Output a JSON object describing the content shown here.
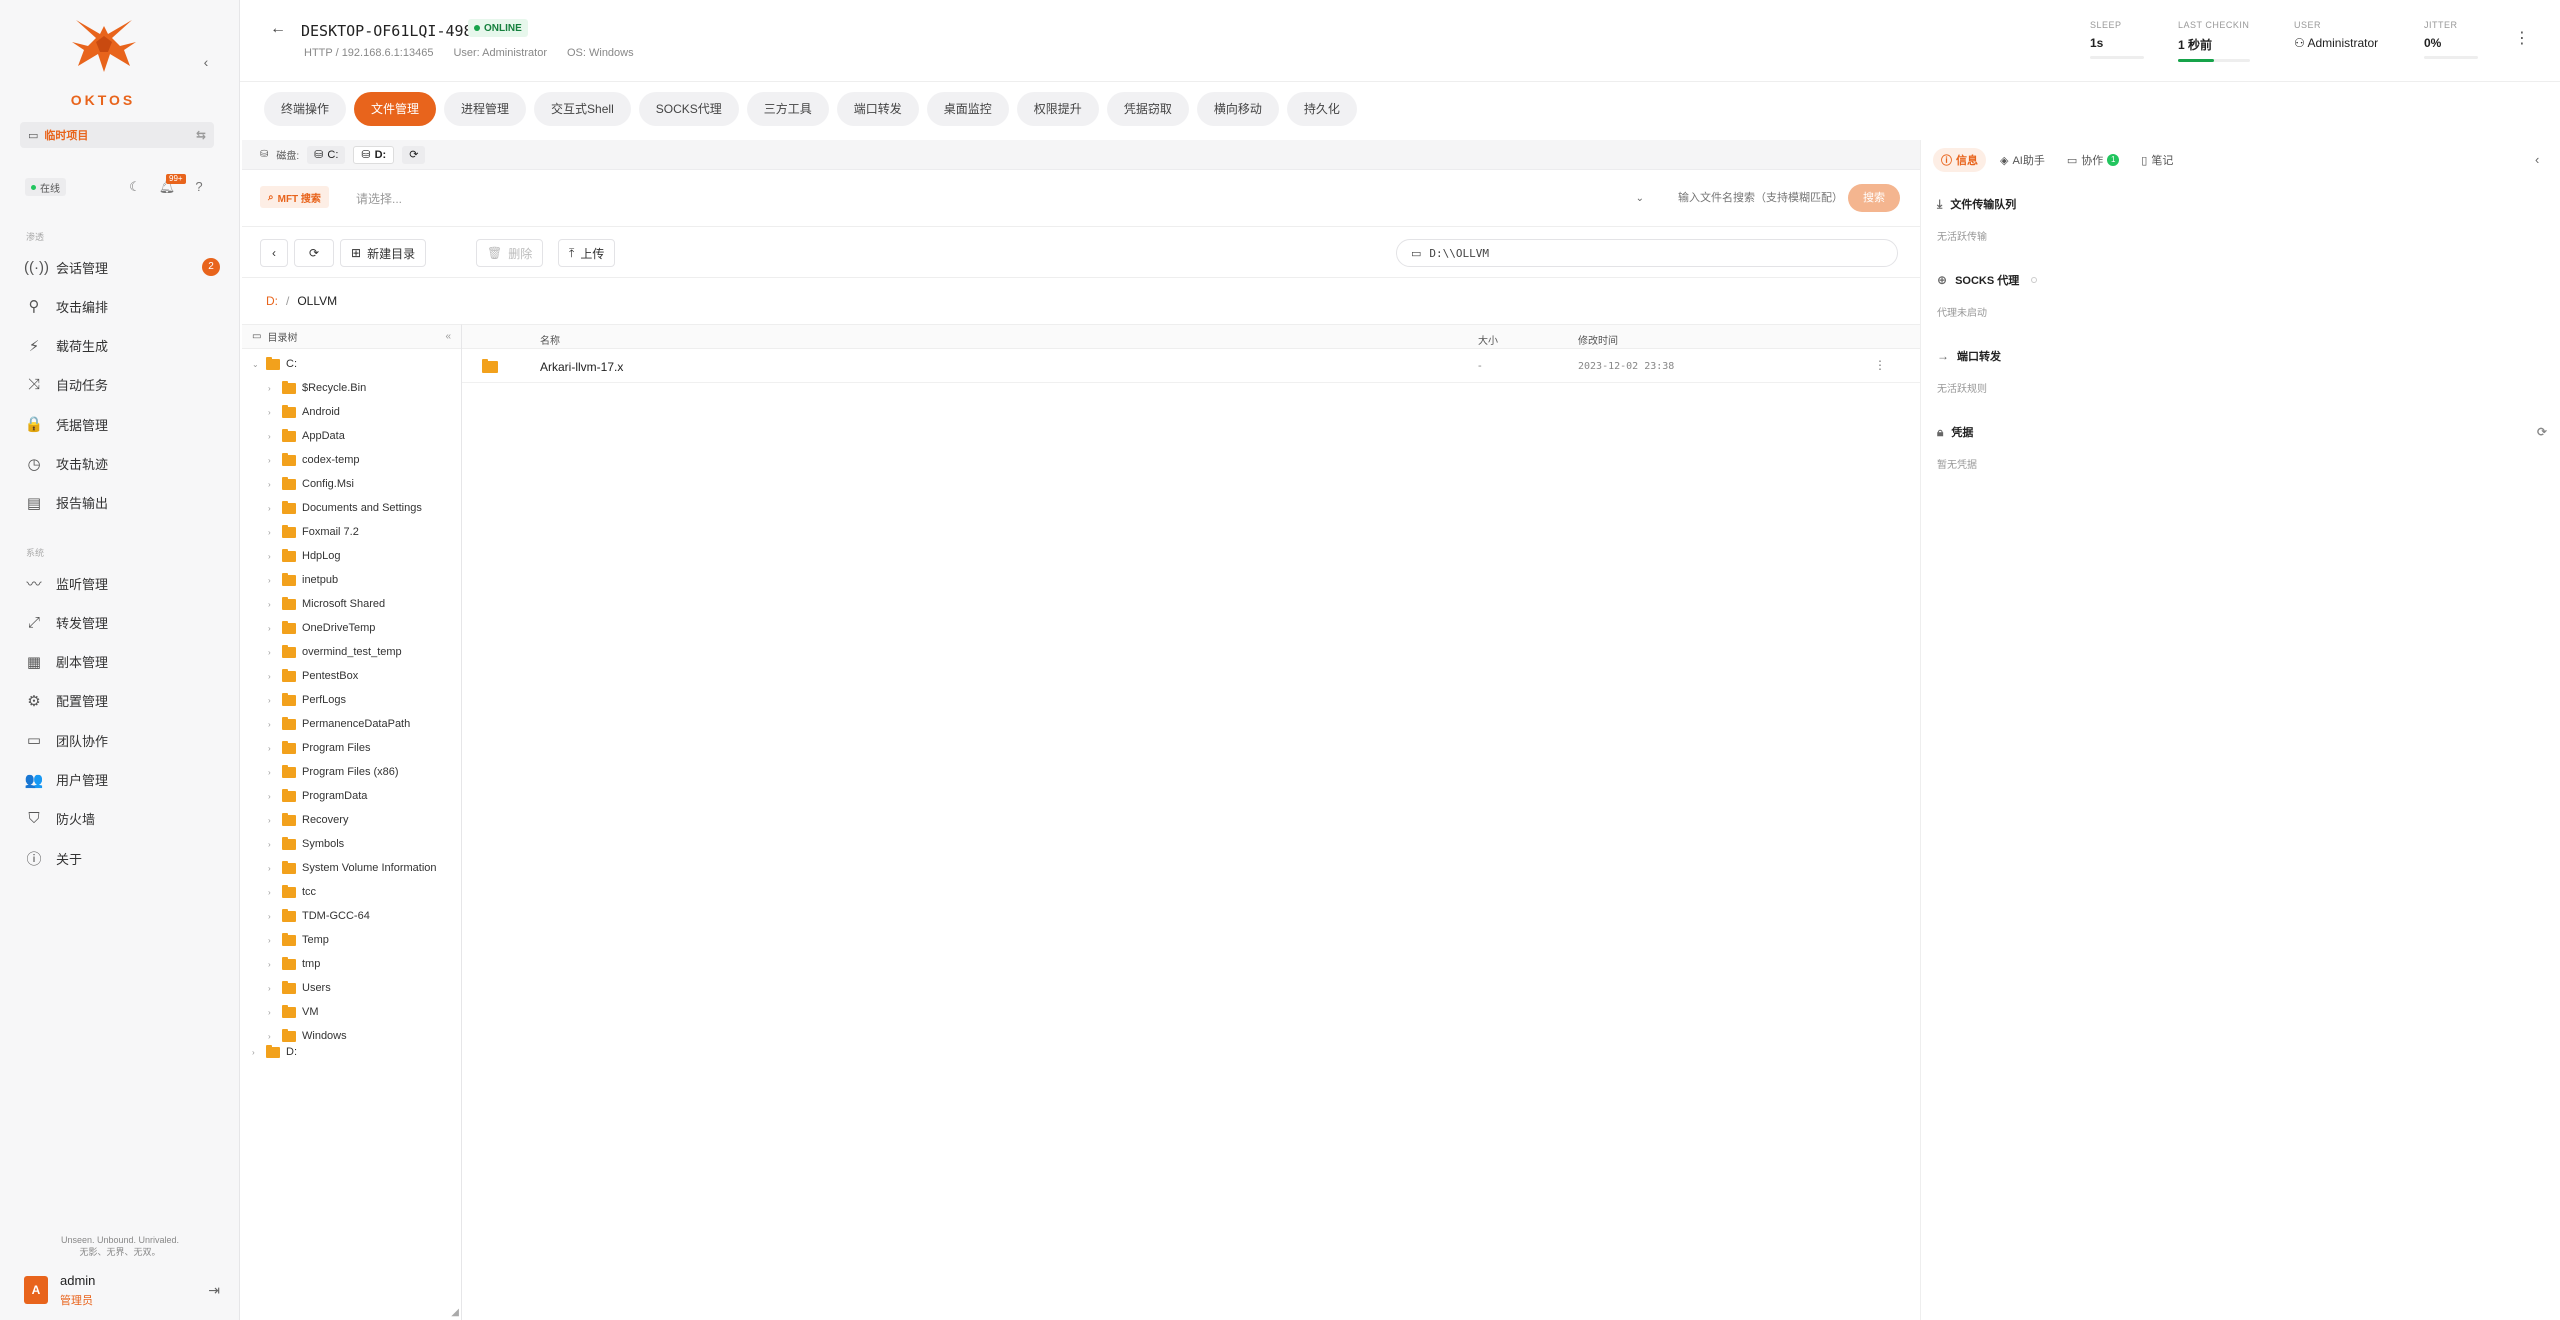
{
  "brand": {
    "name": "OKTOS"
  },
  "sidebar": {
    "project_label": "临时项目",
    "status": "在线",
    "notif_badge": "99+",
    "group_main": "渗透",
    "nav_main": [
      {
        "label": "会话管理",
        "icon": "sessions-icon",
        "glyph": "((·))",
        "badge": "2"
      },
      {
        "label": "攻击编排",
        "icon": "attack-orchestration-icon",
        "glyph": "⚲"
      },
      {
        "label": "载荷生成",
        "icon": "payload-icon",
        "glyph": "⚡"
      },
      {
        "label": "自动任务",
        "icon": "auto-task-icon",
        "glyph": "⤨"
      },
      {
        "label": "凭据管理",
        "icon": "credential-lock-icon",
        "glyph": "🔒"
      },
      {
        "label": "攻击轨迹",
        "icon": "timeline-clock-icon",
        "glyph": "◷"
      },
      {
        "label": "报告输出",
        "icon": "report-icon",
        "glyph": "▤"
      }
    ],
    "group_sys": "系统",
    "nav_sys": [
      {
        "label": "监听管理",
        "icon": "listener-icon",
        "glyph": "〰"
      },
      {
        "label": "转发管理",
        "icon": "forward-icon",
        "glyph": "⤢"
      },
      {
        "label": "剧本管理",
        "icon": "playbook-icon",
        "glyph": "▦"
      },
      {
        "label": "配置管理",
        "icon": "settings-gear-icon",
        "glyph": "⚙"
      },
      {
        "label": "团队协作",
        "icon": "team-chat-icon",
        "glyph": "▭"
      },
      {
        "label": "用户管理",
        "icon": "users-icon",
        "glyph": "👥"
      },
      {
        "label": "防火墙",
        "icon": "firewall-shield-icon",
        "glyph": "⛉"
      },
      {
        "label": "关于",
        "icon": "info-icon",
        "glyph": "ⓘ"
      }
    ],
    "motto_line1": "Unseen. Unbound. Unrivaled.",
    "motto_line2": "无影、无界、无双。",
    "user": {
      "initial": "A",
      "name": "admin",
      "role": "管理员"
    }
  },
  "header": {
    "host": "DESKTOP-OF61LQI-4987",
    "status": "ONLINE",
    "meta_conn": "HTTP / 192.168.6.1:13465",
    "meta_user": "User: Administrator",
    "meta_os": "OS: Windows",
    "sleep_label": "SLEEP",
    "sleep_value": "1s",
    "checkin_label": "LAST CHECKIN",
    "checkin_value": "1 秒前",
    "checkin_level": 0.5,
    "user_label": "USER",
    "user_value": "Administrator",
    "jitter_label": "JITTER",
    "jitter_value": "0%"
  },
  "tabs": [
    "终端操作",
    "文件管理",
    "进程管理",
    "交互式Shell",
    "SOCKS代理",
    "三方工具",
    "端口转发",
    "桌面监控",
    "权限提升",
    "凭据窃取",
    "横向移动",
    "持久化"
  ],
  "active_tab": "文件管理",
  "drives": {
    "label": "磁盘:",
    "items": [
      "C:",
      "D:"
    ],
    "active": "D:"
  },
  "mft": {
    "button": "MFT 搜索",
    "placeholder": "请选择...",
    "search_placeholder": "输入文件名搜索（支持模糊匹配）",
    "search_button": "搜索"
  },
  "toolbar": {
    "new_dir": "新建目录",
    "delete": "删除",
    "upload": "上传",
    "path": "D:\\\\OLLVM"
  },
  "breadcrumb": {
    "root": "D:",
    "sep": "/",
    "current": "OLLVM"
  },
  "tree": {
    "title": "目录树",
    "root_c": "C:",
    "children": [
      "$Recycle.Bin",
      "Android",
      "AppData",
      "codex-temp",
      "Config.Msi",
      "Documents and Settings",
      "Foxmail 7.2",
      "HdpLog",
      "inetpub",
      "Microsoft Shared",
      "OneDriveTemp",
      "overmind_test_temp",
      "PentestBox",
      "PerfLogs",
      "PermanenceDataPath",
      "Program Files",
      "Program Files (x86)",
      "ProgramData",
      "Recovery",
      "Symbols",
      "System Volume Information",
      "tcc",
      "TDM-GCC-64",
      "Temp",
      "tmp",
      "Users",
      "VM",
      "Windows"
    ],
    "root_d": "D:"
  },
  "files": {
    "columns": {
      "name": "名称",
      "size": "大小",
      "mtime": "修改时间"
    },
    "rows": [
      {
        "name": "Arkari-llvm-17.x",
        "size": "-",
        "mtime": "2023-12-02 23:38"
      }
    ]
  },
  "right_panel": {
    "tabs": [
      {
        "label": "信息",
        "icon": "info-icon"
      },
      {
        "label": "AI助手",
        "icon": "ai-layers-icon"
      },
      {
        "label": "协作",
        "icon": "chat-icon",
        "count": "1"
      },
      {
        "label": "笔记",
        "icon": "note-icon"
      }
    ],
    "sections": [
      {
        "title": "文件传输队列",
        "sub": "无活跃传输",
        "icon": "download-icon",
        "glyph": "⤓"
      },
      {
        "title": "SOCKS 代理",
        "sub": "代理未启动",
        "icon": "globe-icon",
        "glyph": "⊕"
      },
      {
        "title": "端口转发",
        "sub": "无活跃规则",
        "icon": "arrow-right-icon",
        "glyph": "→"
      },
      {
        "title": "凭据",
        "sub": "暂无凭据",
        "icon": "lock-icon",
        "glyph": "🔒"
      }
    ]
  },
  "colors": {
    "accent": "#e8641c",
    "online": "#16a34a",
    "folder": "#f2a11c"
  }
}
